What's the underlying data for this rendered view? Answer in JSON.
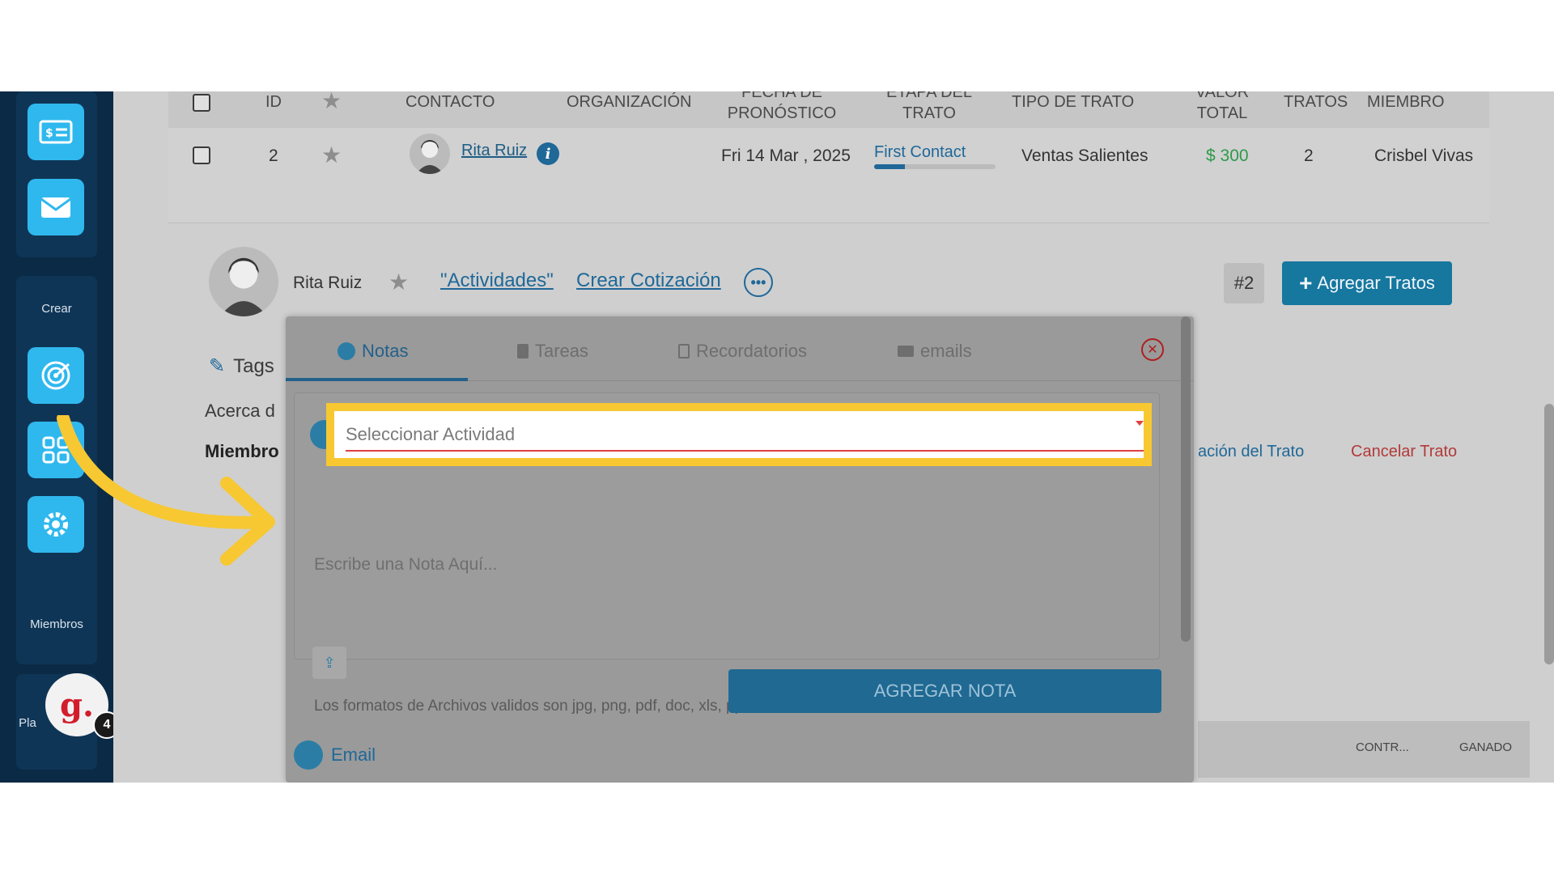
{
  "sidebar": {
    "crear_label": "Crear",
    "miembros_label": "Miembros",
    "planes_label": "Pla",
    "avatar_letter": "g.",
    "notification_count": "4"
  },
  "table": {
    "headers": {
      "id": "ID",
      "contacto": "CONTACTO",
      "organizacion": "ORGANIZACIÓN",
      "fecha": "FECHA DE PRONÓSTICO",
      "etapa": "ETAPA DEL TRATO",
      "tipo": "TIPO DE TRATO",
      "valor": "VALOR TOTAL",
      "tratos": "TRATOS",
      "miembro": "MIEMBRO"
    },
    "row": {
      "id": "2",
      "contacto": "Rita Ruiz",
      "fecha": "Fri 14 Mar , 2025",
      "etapa": "First Contact",
      "etapa_progress": 0.25,
      "tipo": "Ventas Salientes",
      "valor": "$ 300",
      "tratos": "2",
      "miembro": "Crisbel Vivas"
    }
  },
  "deal": {
    "name": "Rita Ruiz",
    "tab_actividades": "\"Actividades\"",
    "tab_cotizacion": "Crear Cotización",
    "id_badge": "#2",
    "add_button": "Agregar Tratos",
    "tags_label": "Tags",
    "acerca_label": "Acerca d",
    "miembro_label": "Miembro",
    "evaluacion_link": "ación del Trato",
    "cancelar_link": "Cancelar Trato",
    "mini_headers": {
      "contr": "CONTR...",
      "ganado": "GANADO"
    }
  },
  "modal": {
    "tabs": {
      "notas": "Notas",
      "tareas": "Tareas",
      "recordatorios": "Recordatorios",
      "emails": "emails"
    },
    "select_placeholder": "Seleccionar Actividad",
    "note_placeholder": "Escribe una Nota Aquí...",
    "formats_text": "Los formatos de Archivos validos son jpg, png, pdf, doc, xls, ppt",
    "add_note_button": "AGREGAR NOTA",
    "email_label": "Email"
  },
  "colors": {
    "highlight": "#f7c832",
    "primary": "#16779f",
    "sidebar": "#0b2a45",
    "danger": "#b23a3a"
  }
}
